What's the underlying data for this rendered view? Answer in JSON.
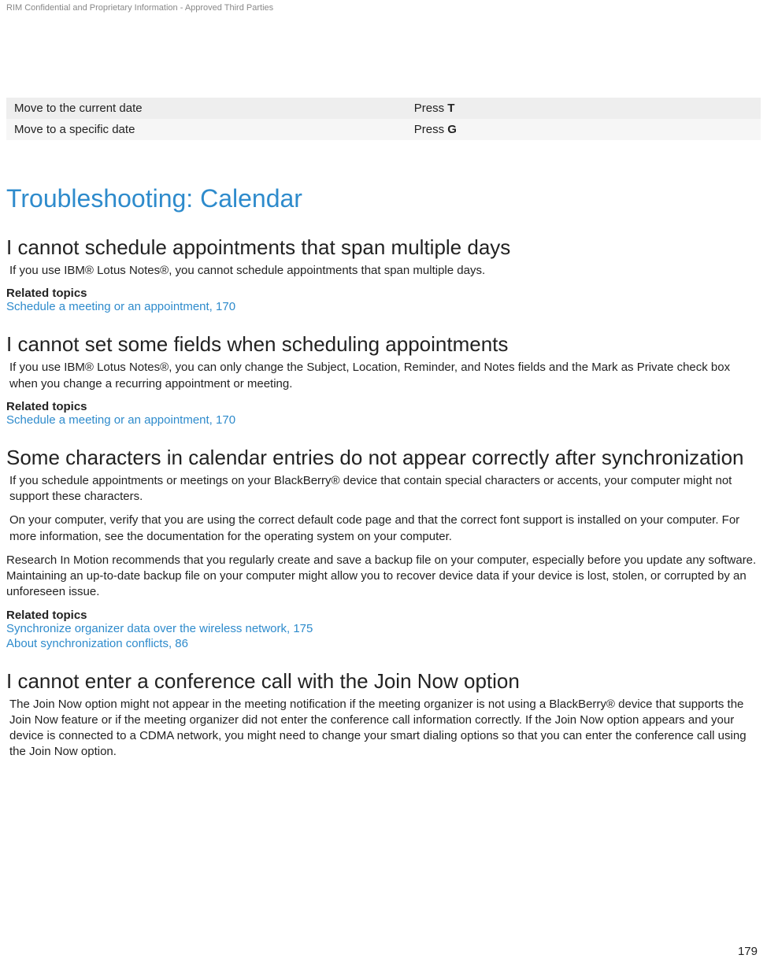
{
  "header": "RIM Confidential and Proprietary Information - Approved Third Parties",
  "shortcuts": [
    {
      "action": "Move to the current date",
      "keyPrefix": "Press ",
      "key": "T"
    },
    {
      "action": "Move to a specific date",
      "keyPrefix": "Press ",
      "key": "G"
    }
  ],
  "sectionTitle": "Troubleshooting: Calendar",
  "topics": [
    {
      "heading": "I cannot schedule appointments that span multiple days",
      "paragraphs": [
        "If you use IBM® Lotus Notes®, you cannot schedule appointments that span multiple days."
      ],
      "relatedLabel": "Related topics",
      "relatedLinks": [
        "Schedule a meeting or an appointment, 170"
      ]
    },
    {
      "heading": "I cannot set some fields when scheduling appointments",
      "paragraphs": [
        "If you use IBM® Lotus Notes®, you can only change the Subject, Location, Reminder, and Notes fields and the Mark as Private check box when you change a recurring appointment or meeting."
      ],
      "relatedLabel": "Related topics",
      "relatedLinks": [
        "Schedule a meeting or an appointment, 170"
      ]
    },
    {
      "heading": "Some characters in calendar entries do not appear correctly after synchronization",
      "paragraphs": [
        "If you schedule appointments or meetings on your BlackBerry® device that contain special characters or accents, your computer might not support these characters.",
        "On your computer, verify that you are using the correct default code page and that the correct font support is installed on your computer. For more information, see the documentation for the operating system on your computer.",
        "Research In Motion recommends that you regularly create and save a backup file on your computer, especially before you update any software. Maintaining an up-to-date backup file on your computer might allow you to recover device data if your device is lost, stolen, or corrupted by an unforeseen issue."
      ],
      "relatedLabel": "Related topics",
      "relatedLinks": [
        "Synchronize organizer data over the wireless network, 175",
        "About synchronization conflicts, 86"
      ]
    },
    {
      "heading": "I cannot enter a conference call with the Join Now option",
      "paragraphs": [
        "The Join Now option might not appear in the meeting notification if the meeting organizer is not using a BlackBerry® device that supports the Join Now feature or if the meeting organizer did not enter the conference call information correctly. If the Join Now option appears and your device is connected to a CDMA network, you might need to change your smart dialing options so that you can enter the conference call using the Join Now option."
      ],
      "relatedLabel": null,
      "relatedLinks": []
    }
  ],
  "pageNumber": "179"
}
